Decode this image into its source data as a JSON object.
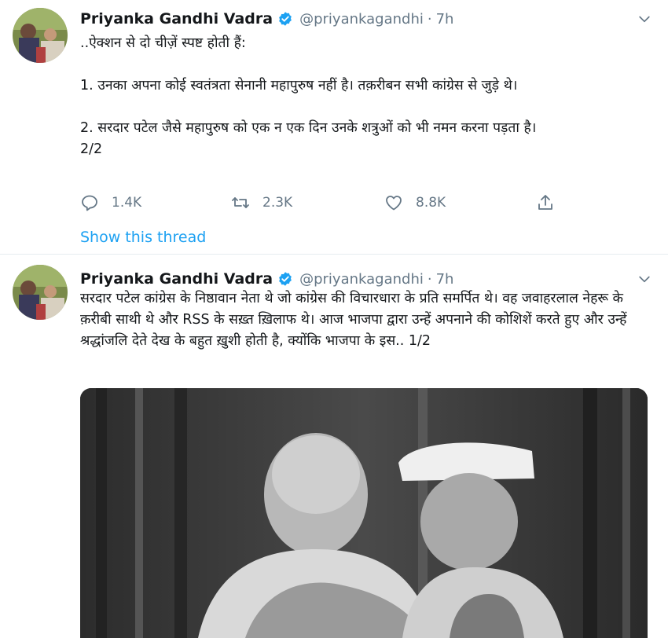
{
  "tweets": [
    {
      "name": "Priyanka Gandhi Vadra",
      "handle": "@priyankagandhi",
      "separator": "·",
      "time": "7h",
      "lines": [
        "..ऐक्शन से दो चीज़ें स्पष्ट होती हैं:",
        "",
        "1. उनका अपना कोई स्वतंत्रता सेनानी महापुरुष नहीं है। तक़रीबन सभी कांग्रेस से जुड़े थे।",
        "",
        "2. सरदार पटेल जैसे महापुरुष को एक न एक दिन उनके शत्रुओं को भी नमन करना पड़ता है।",
        "2/2"
      ],
      "replies": "1.4K",
      "retweets": "2.3K",
      "likes": "8.8K",
      "thread_link": "Show this thread"
    },
    {
      "name": "Priyanka Gandhi Vadra",
      "handle": "@priyankagandhi",
      "separator": "·",
      "time": "7h",
      "text": "सरदार पटेल कांग्रेस के निष्ठावान नेता थे जो कांग्रेस की विचारधारा के प्रति समर्पित थे। वह जवाहरलाल नेहरू के क़रीबी साथी थे और RSS के सख़्त ख़िलाफ थे। आज भाजपा द्वारा उन्हें अपनाने की कोशिशें करते हुए और उन्हें श्रद्धांजलि देते देख के बहुत ख़ुशी होती है, क्योंकि भाजपा के इस.. 1/2"
    }
  ],
  "colors": {
    "link": "#1da1f2",
    "secondary_text": "#657786",
    "verified_badge": "#1da1f2"
  },
  "icons": [
    "verified-icon",
    "chevron-down-icon",
    "reply-icon",
    "retweet-icon",
    "like-icon",
    "share-icon"
  ]
}
